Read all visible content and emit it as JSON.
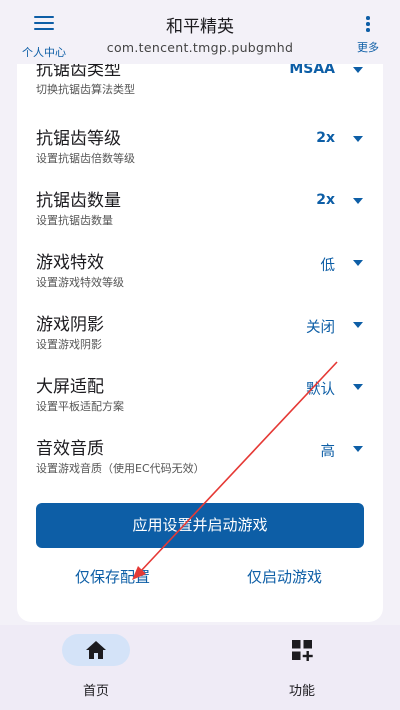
{
  "header": {
    "menu_label": "个人中心",
    "title": "和平精英",
    "subtitle": "com.tencent.tmgp.pubgmhd",
    "more_label": "更多"
  },
  "settings": [
    {
      "title": "抗锯齿类型",
      "desc": "切换抗锯齿算法类型",
      "value": "MSAA"
    },
    {
      "title": "抗锯齿等级",
      "desc": "设置抗锯齿倍数等级",
      "value": "2x"
    },
    {
      "title": "抗锯齿数量",
      "desc": "设置抗锯齿数量",
      "value": "2x"
    },
    {
      "title": "游戏特效",
      "desc": "设置游戏特效等级",
      "value": "低"
    },
    {
      "title": "游戏阴影",
      "desc": "设置游戏阴影",
      "value": "关闭"
    },
    {
      "title": "大屏适配",
      "desc": "设置平板适配方案",
      "value": "默认"
    },
    {
      "title": "音效音质",
      "desc": "设置游戏音质（使用EC代码无效）",
      "value": "高"
    }
  ],
  "actions": {
    "apply_label": "应用设置并启动游戏",
    "save_label": "仅保存配置",
    "launch_label": "仅启动游戏"
  },
  "bottom_nav": {
    "home_label": "首页",
    "func_label": "功能"
  },
  "colors": {
    "accent": "#0d5ea6",
    "annotation_arrow": "#e53935",
    "nav_active_bg": "#d4e3f8"
  },
  "icons": {
    "menu": "hamburger-icon",
    "more": "more-vertical-icon",
    "dropdown": "caret-down-icon",
    "home": "home-icon",
    "func": "widgets-add-icon"
  }
}
